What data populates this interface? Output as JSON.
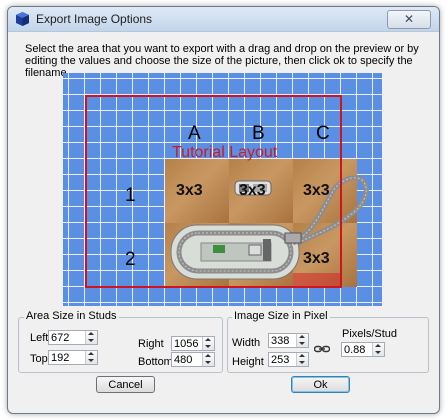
{
  "window": {
    "title": "Export Image Options",
    "close_glyph": "✕"
  },
  "instructions": "Select the area that you want to export with a drag and drop on the preview or by editing the values and choose the size of the picture, then click ok to specify the filename.",
  "preview": {
    "layout_title": "Tutorial Layout",
    "column_labels": [
      "A",
      "B",
      "C"
    ],
    "row_labels": [
      "1",
      "2"
    ],
    "board_label": "3x3"
  },
  "area_group": {
    "title": "Area Size in Studs",
    "left_label": "Left",
    "left_value": "672",
    "top_label": "Top",
    "top_value": "192",
    "right_label": "Right",
    "right_value": "1056",
    "bottom_label": "Bottom",
    "bottom_value": "480"
  },
  "image_group": {
    "title": "Image Size in Pixel",
    "width_label": "Width",
    "width_value": "338",
    "height_label": "Height",
    "height_value": "253",
    "pixels_per_stud_label": "Pixels/Stud",
    "pixels_per_stud_value": "0.88"
  },
  "buttons": {
    "cancel": "Cancel",
    "ok": "Ok"
  },
  "colors": {
    "preview_background": "#5a8fe3",
    "selection_border": "#d0141c",
    "board_wood": "#b58049"
  }
}
